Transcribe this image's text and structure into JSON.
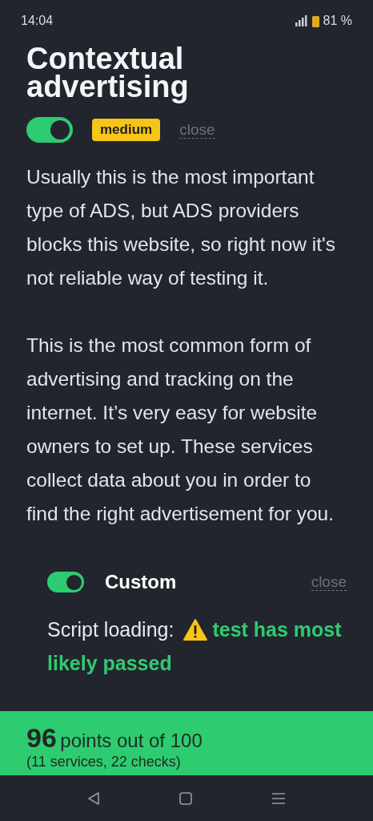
{
  "status_bar": {
    "time": "14:04",
    "battery": "81 %"
  },
  "section": {
    "title": "Contextual advertising",
    "on": true,
    "badge": "medium",
    "close": "close",
    "paragraphs": [
      "Usually this is the most important type of ADS, but ADS providers blocks this website, so right now it's not reliable way of testing it.",
      "This is the most common form of advertising and tracking on the internet. It’s very easy for website owners to set up. These services collect data about you in order to find the right advertisement for you."
    ]
  },
  "services": [
    {
      "name": "Custom",
      "on": true,
      "close": "close",
      "check_label": "Script loading:",
      "result_lines": [
        "test has most",
        "likely passed"
      ]
    }
  ],
  "footer": {
    "score": "96",
    "score_text": "points out of 100",
    "detail": "(11 services, 22 checks)"
  }
}
